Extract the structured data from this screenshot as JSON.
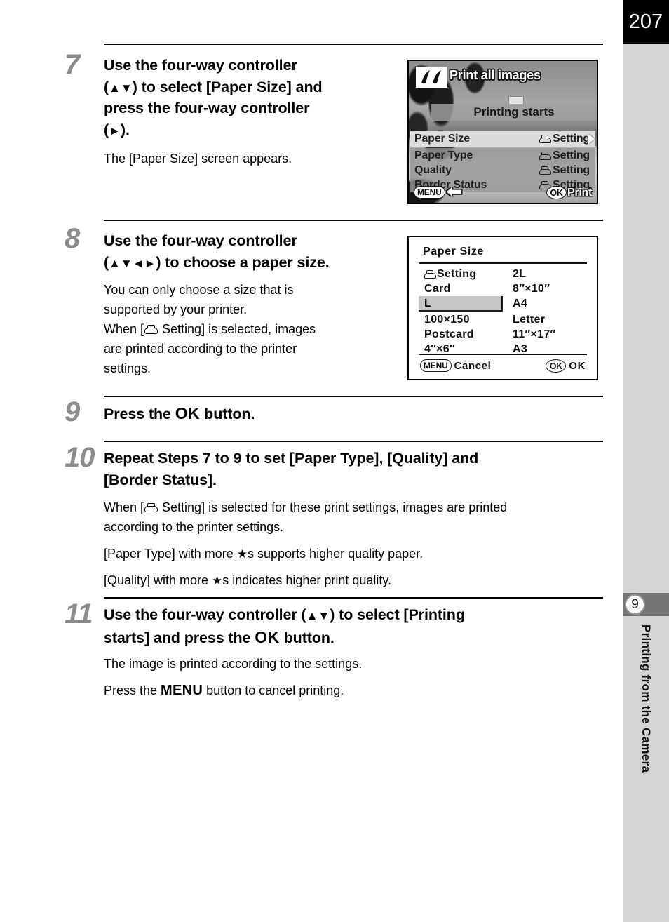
{
  "page": {
    "number": "207",
    "chapter_number": "9",
    "chapter_title": "Printing from the Camera"
  },
  "steps": [
    {
      "number": "7",
      "heading_lines": [
        "Use the four-way controller",
        "( ▲▼ ) to select [Paper Size] and",
        "press the four-way controller",
        "( ► )."
      ],
      "body_lines": [
        "The [Paper Size] screen appears."
      ]
    },
    {
      "number": "8",
      "heading_lines": [
        "Use the four-way controller",
        "( ▲▼◄► ) to choose a paper size."
      ],
      "body_lines": [
        "You can only choose a size that is",
        "supported by your printer.",
        "When [🖶 Setting] is selected, images",
        "are printed according to the printer",
        "settings."
      ]
    },
    {
      "number": "9",
      "heading_lines": [
        "Press the OK button."
      ],
      "body_lines": []
    },
    {
      "number": "10",
      "heading_lines": [
        "Repeat Steps 7 to 9 to set [Paper Type], [Quality] and",
        "[Border Status]."
      ],
      "body_lines": [
        "When [🖶 Setting] is selected for these print settings, images are printed",
        "according to the printer settings.",
        "[Paper Type] with more ★s supports higher quality paper.",
        "[Quality] with more ★s indicates higher print quality."
      ]
    },
    {
      "number": "11",
      "heading_lines": [
        "Use the four-way controller (▲▼) to select [Printing",
        "starts] and press the OK button."
      ],
      "body_lines": [
        "The image is printed according to the settings.",
        "Press the MENU button to cancel printing."
      ]
    }
  ],
  "step7_text": {
    "h_line1": "Use the four-way controller",
    "h_line2_a": "(",
    "h_line2_arrows": "▲▼",
    "h_line2_b": ") to select [Paper Size] and",
    "h_line3": "press the four-way controller",
    "h_line4_a": "(",
    "h_line4_arrow": "►",
    "h_line4_b": ").",
    "body1": "The [Paper Size] screen appears."
  },
  "step8_text": {
    "h_line1": "Use the four-way controller",
    "h_line2_a": "(",
    "h_line2_arrows": "▲▼◄►",
    "h_line2_b": ") to choose a paper size.",
    "body1": "You can only choose a size that is",
    "body2": "supported by your printer.",
    "body3_a": "When [",
    "body3_b": " Setting] is selected, images",
    "body4": "are printed according to the printer",
    "body5": "settings."
  },
  "step9_text": {
    "h_a": "Press the ",
    "h_ok": "OK",
    "h_b": " button."
  },
  "step10_text": {
    "h_line1": "Repeat Steps 7 to 9 to set [Paper Type], [Quality] and",
    "h_line2": "[Border Status].",
    "body1_a": "When [",
    "body1_b": " Setting] is selected for these print settings, images are printed",
    "body2": "according to the printer settings.",
    "body3_a": "[Paper Type] with more ",
    "body3_star": "★",
    "body3_b": "s supports higher quality paper.",
    "body4_a": "[Quality] with more ",
    "body4_star": "★",
    "body4_b": "s indicates higher print quality."
  },
  "step11_text": {
    "h_line1_a": "Use the four-way controller (",
    "h_line1_arrows": "▲▼",
    "h_line1_b": ") to select [Printing",
    "h_line2_a": "starts] and press the ",
    "h_line2_ok": "OK",
    "h_line2_b": " button.",
    "body1": "The image is printed according to the settings.",
    "body2_a": "Press the ",
    "body2_menu": "MENU",
    "body2_b": " button to cancel printing."
  },
  "lcd_screen_1": {
    "icon_name": "print-all-images-icon",
    "title": "Print all images",
    "printing_starts": "Printing starts",
    "menu_rows": [
      {
        "label": "Paper Size",
        "value": "Setting",
        "selected": true
      },
      {
        "label": "Paper Type",
        "value": "Setting",
        "selected": false
      },
      {
        "label": "Quality",
        "value": "Setting",
        "selected": false
      },
      {
        "label": "Border Status",
        "value": "Setting",
        "selected": false
      }
    ],
    "menu_button": "MENU",
    "back_arrow": "⬅",
    "ok_button": "OK",
    "ok_action": "Print"
  },
  "lcd_screen_2": {
    "title": "Paper Size",
    "items_left": [
      "Setting",
      "Card",
      "L",
      "100×150",
      "Postcard",
      "4″×6″"
    ],
    "items_right": [
      "2L",
      "8″×10″",
      "A4",
      "Letter",
      "11″×17″",
      "A3"
    ],
    "selected_item": "L",
    "menu_button": "MENU",
    "menu_action": "Cancel",
    "ok_button": "OK",
    "ok_action": "OK"
  },
  "colors": {
    "page_number_bg": "#000000",
    "sidebar_bg": "#d4d4d4",
    "chapter_tab_bg": "#767676",
    "step_number": "#8c8c8c",
    "text": "#000000"
  }
}
